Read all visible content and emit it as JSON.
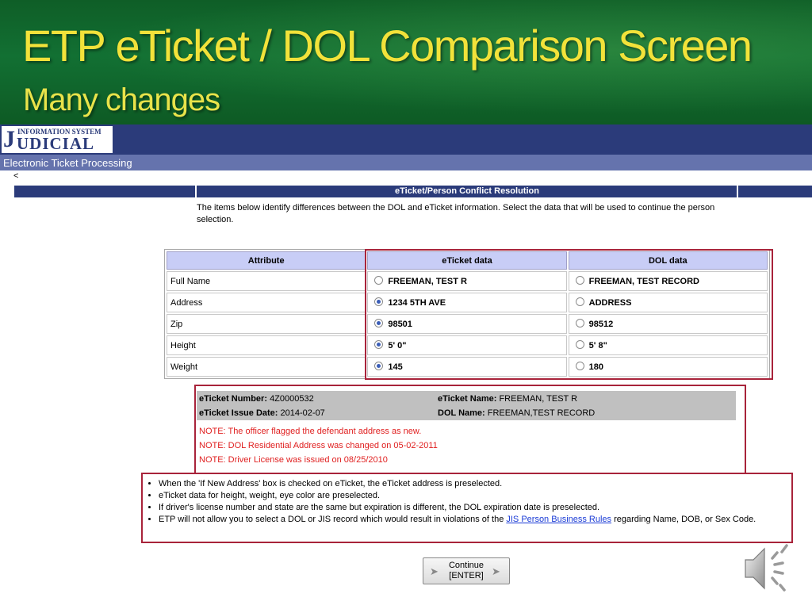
{
  "slide": {
    "title": "ETP eTicket / DOL Comparison Screen",
    "subtitle": "Many changes"
  },
  "banner": {
    "logo_big_letter": "J",
    "logo_small_text": "INFORMATION SYSTEM",
    "logo_rest": "UDICIAL",
    "app_title": "Electronic Ticket Processing",
    "back_link": "<"
  },
  "conflict": {
    "title": "eTicket/Person Conflict Resolution",
    "intro": "The items below identify differences between the DOL and eTicket information. Select the data that will be used to continue the person selection."
  },
  "table": {
    "headers": [
      "Attribute",
      "eTicket data",
      "DOL data"
    ],
    "rows": [
      {
        "attribute": "Full Name",
        "eticket": "FREEMAN, TEST R",
        "dol": "FREEMAN, TEST RECORD",
        "selected": "none"
      },
      {
        "attribute": "Address",
        "eticket": "1234 5TH AVE",
        "dol": "ADDRESS",
        "selected": "eticket"
      },
      {
        "attribute": "Zip",
        "eticket": "98501",
        "dol": "98512",
        "selected": "eticket"
      },
      {
        "attribute": "Height",
        "eticket": "5' 0\"",
        "dol": "5' 8\"",
        "selected": "eticket"
      },
      {
        "attribute": "Weight",
        "eticket": "145",
        "dol": "180",
        "selected": "eticket"
      }
    ]
  },
  "summary": {
    "ticket_number_label": "eTicket Number:",
    "ticket_number": "4Z0000532",
    "ticket_name_label": "eTicket Name:",
    "ticket_name": "FREEMAN, TEST R",
    "issue_date_label": "eTicket Issue Date:",
    "issue_date": "2014-02-07",
    "dol_name_label": "DOL Name:",
    "dol_name": "FREEMAN,TEST RECORD",
    "notes": [
      "NOTE: The officer flagged the defendant address as new.",
      "NOTE: DOL Residential Address was changed on 05-02-2011",
      "NOTE: Driver License was issued on 08/25/2010"
    ]
  },
  "bullets": {
    "b1": "When the 'If New Address' box is checked on eTicket, the eTicket address is preselected.",
    "b2": "eTicket data for height, weight, eye color are preselected.",
    "b3": "If driver's license number and state are the same but expiration is different, the DOL expiration date is preselected.",
    "b4_pre": "ETP will not allow you to select a DOL or JIS record which would result in violations of the ",
    "b4_link": "JIS Person Business Rules",
    "b4_post": " regarding Name, DOB, or Sex Code."
  },
  "button": {
    "continue_line1": "Continue",
    "continue_line2": "[ENTER]"
  },
  "colors": {
    "title_yellow": "#f2e23a",
    "banner_navy": "#2b3b7a",
    "table_header": "#c8cdf6",
    "highlight_red": "#a8233a",
    "note_red": "#e02020",
    "link_blue": "#1a3bd6"
  },
  "icons": {
    "speaker": "speaker-icon",
    "radio": "radio-button-icon",
    "arrow": "arrow-right-icon"
  }
}
